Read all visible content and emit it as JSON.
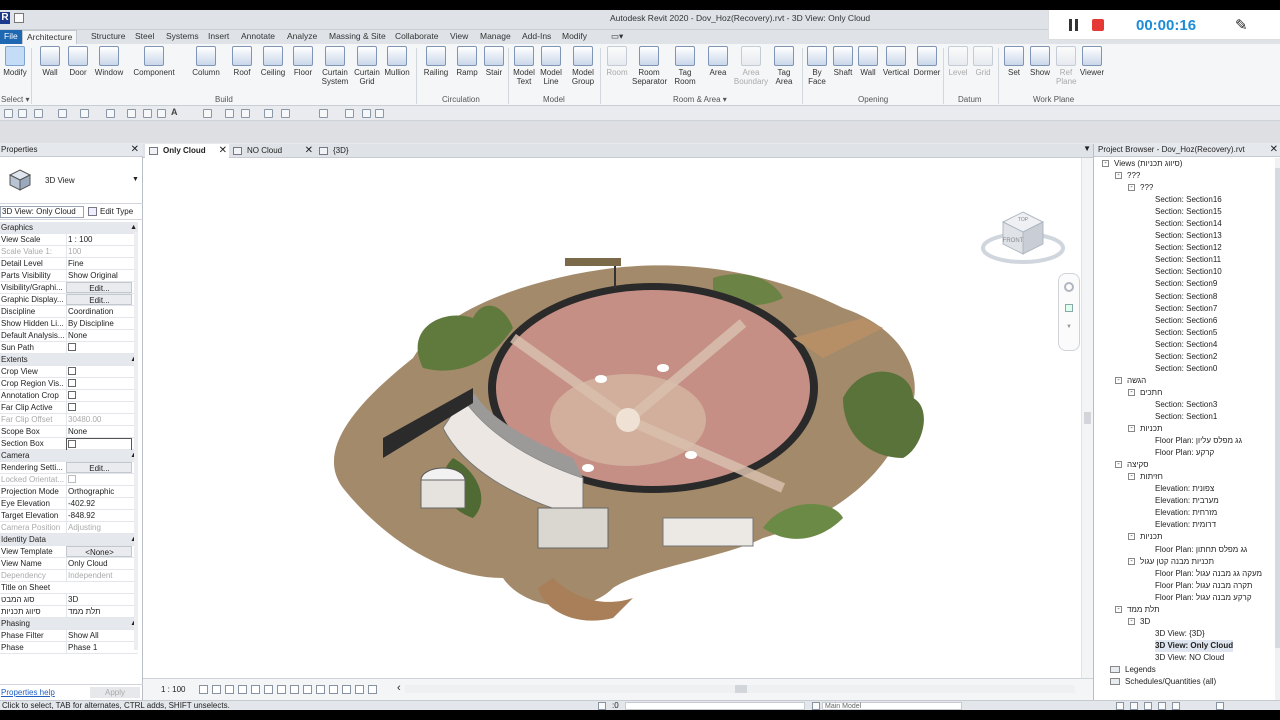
{
  "app": {
    "logo": "R",
    "title": "Autodesk Revit 2020 - Dov_Hoz(Recovery).rvt - 3D View: Only Cloud"
  },
  "recorder": {
    "time": "00:00:16",
    "accent": "#1b8cd6",
    "stop_color": "#e53935"
  },
  "tabs": [
    "File",
    "Architecture",
    "Structure",
    "Steel",
    "Systems",
    "Insert",
    "Annotate",
    "Analyze",
    "Massing & Site",
    "Collaborate",
    "View",
    "Manage",
    "Add-Ins",
    "Modify"
  ],
  "ribbon": {
    "modify": "Modify",
    "select": "Select ▾",
    "build": {
      "label": "Build",
      "buttons": [
        "Wall",
        "Door",
        "Window",
        "Component",
        "Column",
        "Roof",
        "Ceiling",
        "Floor",
        "Curtain System",
        "Curtain Grid",
        "Mullion"
      ]
    },
    "circulation": {
      "label": "Circulation",
      "buttons": [
        "Railing",
        "Ramp",
        "Stair"
      ]
    },
    "model": {
      "label": "Model",
      "buttons": [
        "Model Text",
        "Model Line",
        "Model Group"
      ]
    },
    "room_area": {
      "label": "Room & Area ▾",
      "buttons": [
        "Room",
        "Room Separator",
        "Tag Room",
        "Area",
        "Area Boundary",
        "Tag Area"
      ]
    },
    "opening": {
      "label": "Opening",
      "buttons": [
        "By Face",
        "Shaft",
        "Wall",
        "Vertical",
        "Dormer"
      ]
    },
    "datum": {
      "label": "Datum",
      "buttons": [
        "Level",
        "Grid"
      ]
    },
    "work_plane": {
      "label": "Work Plane",
      "buttons": [
        "Set",
        "Show",
        "Ref Plane",
        "Viewer"
      ]
    }
  },
  "properties": {
    "header": "Properties",
    "type_name": "3D View",
    "selector": "3D View: Only Cloud",
    "edit_type": "Edit Type",
    "rows": [
      {
        "kind": "section",
        "k": "Graphics"
      },
      {
        "k": "View Scale",
        "v": "1 : 100"
      },
      {
        "k": "Scale Value    1:",
        "v": "100",
        "dim": true
      },
      {
        "k": "Detail Level",
        "v": "Fine"
      },
      {
        "k": "Parts Visibility",
        "v": "Show Original"
      },
      {
        "k": "Visibility/Graphi...",
        "v": "Edit...",
        "btn": true
      },
      {
        "k": "Graphic Display...",
        "v": "Edit...",
        "btn": true
      },
      {
        "k": "Discipline",
        "v": "Coordination"
      },
      {
        "k": "Show Hidden Li...",
        "v": "By Discipline"
      },
      {
        "k": "Default Analysis...",
        "v": "None"
      },
      {
        "k": "Sun Path",
        "chk": true
      },
      {
        "kind": "section",
        "k": "Extents"
      },
      {
        "k": "Crop View",
        "chk": true
      },
      {
        "k": "Crop Region Vis...",
        "chk": true
      },
      {
        "k": "Annotation Crop",
        "chk": true
      },
      {
        "k": "Far Clip Active",
        "chk": true
      },
      {
        "k": "Far Clip Offset",
        "v": "30480.00",
        "dim": true
      },
      {
        "k": "Scope Box",
        "v": "None"
      },
      {
        "k": "Section Box",
        "chk": true,
        "boxed": true
      },
      {
        "kind": "section",
        "k": "Camera"
      },
      {
        "k": "Rendering Setti...",
        "v": "Edit...",
        "btn": true
      },
      {
        "k": "Locked Orientat...",
        "chk": true,
        "dim": true
      },
      {
        "k": "Projection Mode",
        "v": "Orthographic"
      },
      {
        "k": "Eye Elevation",
        "v": "-402.92"
      },
      {
        "k": "Target Elevation",
        "v": "-848.92"
      },
      {
        "k": "Camera Position",
        "v": "Adjusting",
        "dim": true
      },
      {
        "kind": "section",
        "k": "Identity Data"
      },
      {
        "k": "View Template",
        "v": "<None>",
        "btn": true
      },
      {
        "k": "View Name",
        "v": "Only Cloud"
      },
      {
        "k": "Dependency",
        "v": "Independent",
        "dim": true
      },
      {
        "k": "Title on Sheet",
        "v": ""
      },
      {
        "k": "סוג המבט",
        "v": "3D"
      },
      {
        "k": "סיווג תכניות",
        "v": "תלת ממד"
      },
      {
        "kind": "section",
        "k": "Phasing"
      },
      {
        "k": "Phase Filter",
        "v": "Show All"
      },
      {
        "k": "Phase",
        "v": "Phase 1"
      }
    ],
    "help": "Properties help",
    "apply": "Apply"
  },
  "viewtabs": [
    {
      "label": "Only Cloud",
      "active": true
    },
    {
      "label": "NO Cloud",
      "active": false
    },
    {
      "label": "{3D}",
      "active": false
    }
  ],
  "viewcube": {
    "top": "TOP",
    "front": "FRONT"
  },
  "view_scale": "1 : 100",
  "browser": {
    "header": "Project Browser - Dov_Hoz(Recovery).rvt",
    "nodes": [
      {
        "d": 0,
        "t": "-",
        "label": "Views (סיווג תכניות)"
      },
      {
        "d": 1,
        "t": "-",
        "label": "???"
      },
      {
        "d": 2,
        "t": "-",
        "label": "???"
      },
      {
        "d": 3,
        "label": "Section: Section16"
      },
      {
        "d": 3,
        "label": "Section: Section15"
      },
      {
        "d": 3,
        "label": "Section: Section14"
      },
      {
        "d": 3,
        "label": "Section: Section13"
      },
      {
        "d": 3,
        "label": "Section: Section12"
      },
      {
        "d": 3,
        "label": "Section: Section11"
      },
      {
        "d": 3,
        "label": "Section: Section10"
      },
      {
        "d": 3,
        "label": "Section: Section9"
      },
      {
        "d": 3,
        "label": "Section: Section8"
      },
      {
        "d": 3,
        "label": "Section: Section7"
      },
      {
        "d": 3,
        "label": "Section: Section6"
      },
      {
        "d": 3,
        "label": "Section: Section5"
      },
      {
        "d": 3,
        "label": "Section: Section4"
      },
      {
        "d": 3,
        "label": "Section: Section2"
      },
      {
        "d": 3,
        "label": "Section: Section0"
      },
      {
        "d": 1,
        "t": "-",
        "label": "הגשה"
      },
      {
        "d": 2,
        "t": "-",
        "label": "חתכים"
      },
      {
        "d": 3,
        "label": "Section: Section3"
      },
      {
        "d": 3,
        "label": "Section: Section1"
      },
      {
        "d": 2,
        "t": "-",
        "label": "תכניות"
      },
      {
        "d": 3,
        "label": "Floor Plan: גג מפלס עליון"
      },
      {
        "d": 3,
        "label": "Floor Plan: קרקע"
      },
      {
        "d": 1,
        "t": "-",
        "label": "סקיצה"
      },
      {
        "d": 2,
        "t": "-",
        "label": "חזיתות"
      },
      {
        "d": 3,
        "label": "Elevation: צפונית"
      },
      {
        "d": 3,
        "label": "Elevation: מערבית"
      },
      {
        "d": 3,
        "label": "Elevation: מזרחית"
      },
      {
        "d": 3,
        "label": "Elevation: דרומית"
      },
      {
        "d": 2,
        "t": "-",
        "label": "תכניות"
      },
      {
        "d": 3,
        "label": "Floor Plan: גג מפלס תחתון"
      },
      {
        "d": 2,
        "t": "-",
        "label": "תכניות מבנה קטן עגול"
      },
      {
        "d": 3,
        "label": "Floor Plan: מעקה גג מבנה עגול"
      },
      {
        "d": 3,
        "label": "Floor Plan: תקרה מבנה עגול"
      },
      {
        "d": 3,
        "label": "Floor Plan: קרקע מבנה עגול"
      },
      {
        "d": 1,
        "t": "-",
        "label": "תלת ממד"
      },
      {
        "d": 2,
        "t": "-",
        "label": "3D"
      },
      {
        "d": 3,
        "label": "3D View: {3D}"
      },
      {
        "d": 3,
        "label": "3D View: Only Cloud",
        "bold": true
      },
      {
        "d": 3,
        "label": "3D View: NO Cloud"
      },
      {
        "d": 0,
        "icon": true,
        "label": "Legends"
      },
      {
        "d": 0,
        "icon": true,
        "label": "Schedules/Quantities (all)"
      }
    ]
  },
  "statusbar": {
    "message": "Click to select, TAB for alternates, CTRL adds, SHIFT unselects.",
    "zero": ":0",
    "workset": "Main Model"
  }
}
